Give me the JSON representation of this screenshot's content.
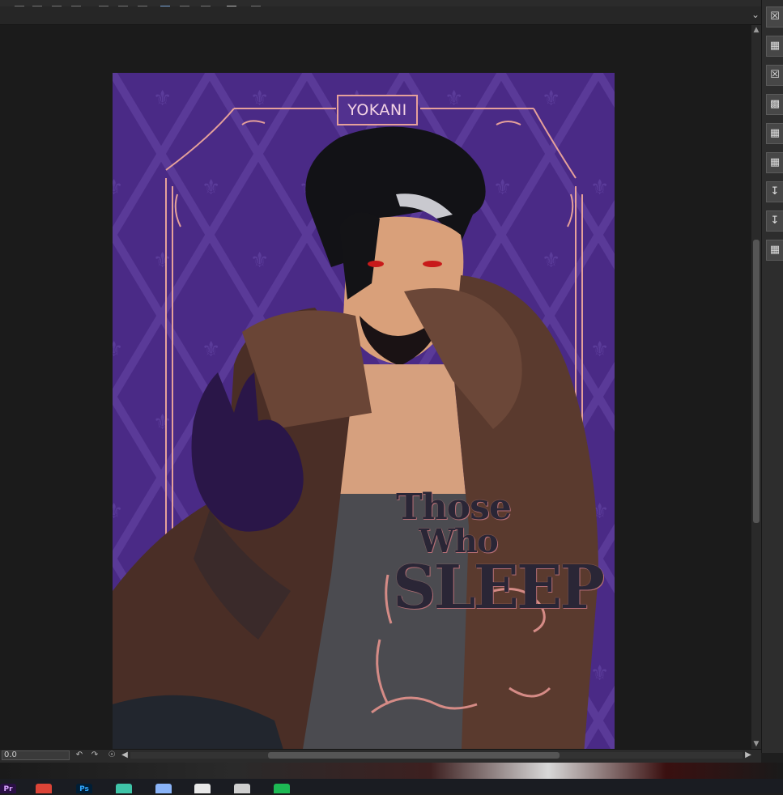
{
  "artwork": {
    "title_badge": "YOKANI",
    "logo_line1": "Those",
    "logo_line2": "Who",
    "logo_line3": "SLEEP",
    "background_color": "#4a2a86",
    "frame_color": "#e5a09a"
  },
  "statusbar": {
    "zoom_value": "0.0"
  },
  "taskbar": {
    "apps": [
      {
        "icon": "premiere-icon",
        "label": "Pr",
        "color": "#2a0f45",
        "text_color": "#d9a3ff"
      },
      {
        "icon": "chrome-icon",
        "label": "",
        "color": "#db4437"
      },
      {
        "icon": "photoshop-icon",
        "label": "Ps",
        "color": "#001e36",
        "text_color": "#31a8ff"
      },
      {
        "icon": "tool-icon",
        "label": "",
        "color": "#3fc4a8"
      },
      {
        "icon": "globe-icon",
        "label": "",
        "color": "#8ab4f8"
      },
      {
        "icon": "document-icon",
        "label": "",
        "color": "#e8e8e8"
      },
      {
        "icon": "app-icon",
        "label": "",
        "color": "#cfcfcf"
      },
      {
        "icon": "spotify-icon",
        "label": "",
        "color": "#1db954"
      }
    ]
  },
  "right_panel": {
    "buttons": [
      "close-layer-icon",
      "grid-icon",
      "close-layer-icon",
      "checker-icon",
      "grid-icon",
      "grid-move-icon",
      "download-icon",
      "download-icon",
      "grid-icon"
    ]
  }
}
